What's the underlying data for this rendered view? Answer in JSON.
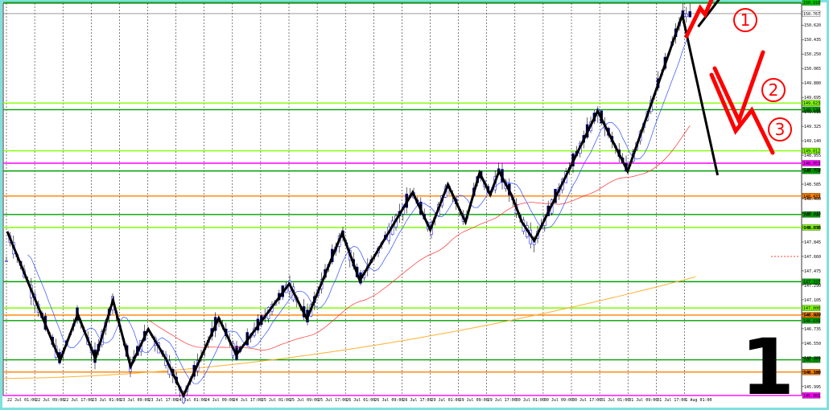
{
  "chart_data": {
    "type": "candlestick",
    "y_ticks": [
      "150.620",
      "150.435",
      "150.250",
      "150.065",
      "149.880",
      "149.695",
      "149.510",
      "149.325",
      "149.140",
      "148.955",
      "148.770",
      "148.585",
      "148.400",
      "148.215",
      "148.030",
      "147.845",
      "147.660",
      "147.475",
      "147.290",
      "147.105",
      "146.920",
      "146.735",
      "146.550",
      "146.365",
      "146.180",
      "145.995"
    ],
    "x_ticks": [
      "22 Jul 01:00",
      "22 Jul 09:00",
      "22 Jul 17:00",
      "23 Jul 01:00",
      "23 Jul 09:00",
      "23 Jul 17:00",
      "24 Jul 01:00",
      "24 Jul 09:00",
      "24 Jul 17:00",
      "25 Jul 01:00",
      "25 Jul 09:00",
      "25 Jul 17:00",
      "26 Jul 01:00",
      "26 Jul 09:00",
      "26 Jul 17:00",
      "29 Jul 01:00",
      "29 Jul 09:00",
      "29 Jul 17:00",
      "30 Jul 01:00",
      "30 Jul 09:00",
      "30 Jul 17:00",
      "31 Jul 01:00",
      "31 Jul 09:00",
      "31 Jul 17:00",
      "1 Aug 01:00"
    ],
    "ylim": [
      145.88,
      150.9
    ],
    "price_badges": [
      {
        "label": "150.910",
        "price": 150.91,
        "color": "#00c800"
      },
      {
        "label": "150.767",
        "price": 150.767,
        "color": "#ffffff"
      },
      {
        "label": "149.623",
        "price": 149.623,
        "color": "#80ff00"
      },
      {
        "label": "149.538",
        "price": 149.538,
        "color": "#00a000"
      },
      {
        "label": "149.012",
        "price": 149.012,
        "color": "#80ff00"
      },
      {
        "label": "148.853",
        "price": 148.853,
        "color": "#ff00ff"
      },
      {
        "label": "148.754",
        "price": 148.754,
        "color": "#00a000"
      },
      {
        "label": "148.433",
        "price": 148.433,
        "color": "#ff8000"
      },
      {
        "label": "148.196",
        "price": 148.196,
        "color": "#00a000"
      },
      {
        "label": "148.030",
        "price": 148.03,
        "color": "#80ff00"
      },
      {
        "label": "147.337",
        "price": 147.337,
        "color": "#00a000"
      },
      {
        "label": "147.000",
        "price": 147.0,
        "color": "#80ff00"
      },
      {
        "label": "146.909",
        "price": 146.909,
        "color": "#ff8000"
      },
      {
        "label": "146.839",
        "price": 146.839,
        "color": "#00a000"
      },
      {
        "label": "146.337",
        "price": 146.337,
        "color": "#00a000"
      },
      {
        "label": "146.180",
        "price": 146.18,
        "color": "#ff8000"
      },
      {
        "label": "145.881",
        "price": 145.881,
        "color": "#ff00ff"
      }
    ],
    "zigzag": [
      {
        "x": 0,
        "y": 147.98
      },
      {
        "x": 3,
        "y": 146.33
      },
      {
        "x": 4,
        "y": 146.92
      },
      {
        "x": 5,
        "y": 146.35
      },
      {
        "x": 6,
        "y": 147.1
      },
      {
        "x": 7,
        "y": 146.25
      },
      {
        "x": 8,
        "y": 146.73
      },
      {
        "x": 9,
        "y": 146.35
      },
      {
        "x": 10,
        "y": 145.88
      },
      {
        "x": 12,
        "y": 146.87
      },
      {
        "x": 13,
        "y": 146.4
      },
      {
        "x": 16,
        "y": 147.31
      },
      {
        "x": 17,
        "y": 146.86
      },
      {
        "x": 19,
        "y": 147.96
      },
      {
        "x": 20,
        "y": 147.35
      },
      {
        "x": 23,
        "y": 148.48
      },
      {
        "x": 24,
        "y": 148.0
      },
      {
        "x": 25,
        "y": 148.58
      },
      {
        "x": 26,
        "y": 148.1
      },
      {
        "x": 26.8,
        "y": 148.73
      },
      {
        "x": 27.4,
        "y": 148.45
      },
      {
        "x": 27.9,
        "y": 148.75
      },
      {
        "x": 28.6,
        "y": 148.45
      },
      {
        "x": 29.2,
        "y": 148.1
      },
      {
        "x": 29.9,
        "y": 147.86
      },
      {
        "x": 33.5,
        "y": 149.52
      },
      {
        "x": 35.2,
        "y": 148.75
      },
      {
        "x": 38.3,
        "y": 150.75
      },
      {
        "x": 40.3,
        "y": 148.7
      }
    ],
    "zigzag_tail": [
      {
        "x": 39.2,
        "y": 150.6
      },
      {
        "x": 40.9,
        "y": 151.1
      }
    ],
    "wave_labels": [
      "1",
      "2",
      "3"
    ],
    "big_label": "1"
  }
}
